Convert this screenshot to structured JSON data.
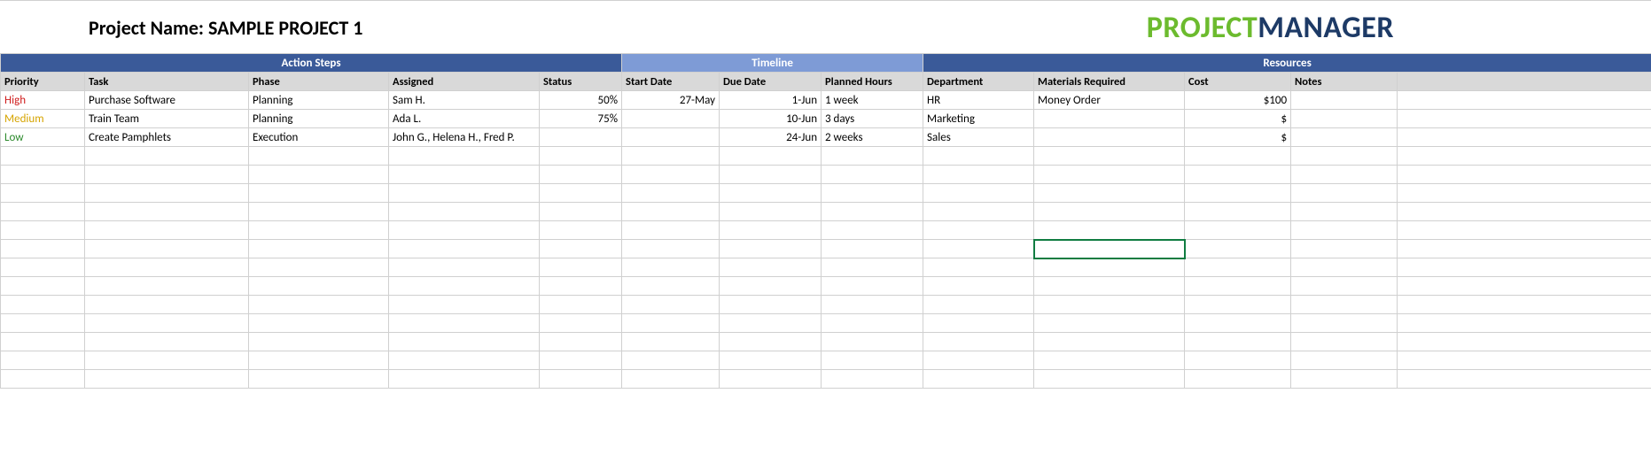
{
  "header": {
    "project_title": "Project Name: SAMPLE PROJECT 1",
    "logo_part1": "PROJECT",
    "logo_part2": "MANAGER"
  },
  "groups": {
    "action": "Action Steps",
    "timeline": "Timeline",
    "resources": "Resources"
  },
  "columns": {
    "priority": "Priority",
    "task": "Task",
    "phase": "Phase",
    "assigned": "Assigned",
    "status": "Status",
    "start_date": "Start Date",
    "due_date": "Due Date",
    "planned_hours": "Planned Hours",
    "department": "Department",
    "materials": "Materials Required",
    "cost": "Cost",
    "notes": "Notes"
  },
  "rows": [
    {
      "priority": "High",
      "priority_class": "priority-high",
      "task": "Purchase Software",
      "phase": "Planning",
      "assigned": "Sam H.",
      "status": "50%",
      "start_date": "27-May",
      "due_date": "1-Jun",
      "planned_hours": "1 week",
      "department": "HR",
      "materials": "Money Order",
      "cost": "$100",
      "notes": ""
    },
    {
      "priority": "Medium",
      "priority_class": "priority-medium",
      "task": "Train Team",
      "phase": "Planning",
      "assigned": "Ada L.",
      "status": "75%",
      "start_date": "",
      "due_date": "10-Jun",
      "planned_hours": "3 days",
      "department": "Marketing",
      "materials": "",
      "cost": "$",
      "notes": ""
    },
    {
      "priority": "Low",
      "priority_class": "priority-low",
      "task": "Create Pamphlets",
      "phase": "Execution",
      "assigned": "John G., Helena H., Fred P.",
      "status": "",
      "start_date": "",
      "due_date": "24-Jun",
      "planned_hours": "2 weeks",
      "department": "Sales",
      "materials": "",
      "cost": "$",
      "notes": ""
    }
  ],
  "empty_row_count": 13,
  "selected_cell": {
    "row_index": 8,
    "col_index": 9
  }
}
